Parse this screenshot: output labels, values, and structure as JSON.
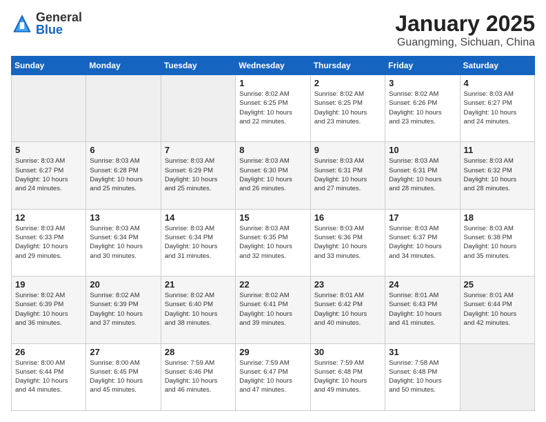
{
  "logo": {
    "general": "General",
    "blue": "Blue"
  },
  "title": "January 2025",
  "subtitle": "Guangming, Sichuan, China",
  "weekdays": [
    "Sunday",
    "Monday",
    "Tuesday",
    "Wednesday",
    "Thursday",
    "Friday",
    "Saturday"
  ],
  "weeks": [
    [
      {
        "day": "",
        "text": ""
      },
      {
        "day": "",
        "text": ""
      },
      {
        "day": "",
        "text": ""
      },
      {
        "day": "1",
        "text": "Sunrise: 8:02 AM\nSunset: 6:25 PM\nDaylight: 10 hours\nand 22 minutes."
      },
      {
        "day": "2",
        "text": "Sunrise: 8:02 AM\nSunset: 6:25 PM\nDaylight: 10 hours\nand 23 minutes."
      },
      {
        "day": "3",
        "text": "Sunrise: 8:02 AM\nSunset: 6:26 PM\nDaylight: 10 hours\nand 23 minutes."
      },
      {
        "day": "4",
        "text": "Sunrise: 8:03 AM\nSunset: 6:27 PM\nDaylight: 10 hours\nand 24 minutes."
      }
    ],
    [
      {
        "day": "5",
        "text": "Sunrise: 8:03 AM\nSunset: 6:27 PM\nDaylight: 10 hours\nand 24 minutes."
      },
      {
        "day": "6",
        "text": "Sunrise: 8:03 AM\nSunset: 6:28 PM\nDaylight: 10 hours\nand 25 minutes."
      },
      {
        "day": "7",
        "text": "Sunrise: 8:03 AM\nSunset: 6:29 PM\nDaylight: 10 hours\nand 25 minutes."
      },
      {
        "day": "8",
        "text": "Sunrise: 8:03 AM\nSunset: 6:30 PM\nDaylight: 10 hours\nand 26 minutes."
      },
      {
        "day": "9",
        "text": "Sunrise: 8:03 AM\nSunset: 6:31 PM\nDaylight: 10 hours\nand 27 minutes."
      },
      {
        "day": "10",
        "text": "Sunrise: 8:03 AM\nSunset: 6:31 PM\nDaylight: 10 hours\nand 28 minutes."
      },
      {
        "day": "11",
        "text": "Sunrise: 8:03 AM\nSunset: 6:32 PM\nDaylight: 10 hours\nand 28 minutes."
      }
    ],
    [
      {
        "day": "12",
        "text": "Sunrise: 8:03 AM\nSunset: 6:33 PM\nDaylight: 10 hours\nand 29 minutes."
      },
      {
        "day": "13",
        "text": "Sunrise: 8:03 AM\nSunset: 6:34 PM\nDaylight: 10 hours\nand 30 minutes."
      },
      {
        "day": "14",
        "text": "Sunrise: 8:03 AM\nSunset: 6:34 PM\nDaylight: 10 hours\nand 31 minutes."
      },
      {
        "day": "15",
        "text": "Sunrise: 8:03 AM\nSunset: 6:35 PM\nDaylight: 10 hours\nand 32 minutes."
      },
      {
        "day": "16",
        "text": "Sunrise: 8:03 AM\nSunset: 6:36 PM\nDaylight: 10 hours\nand 33 minutes."
      },
      {
        "day": "17",
        "text": "Sunrise: 8:03 AM\nSunset: 6:37 PM\nDaylight: 10 hours\nand 34 minutes."
      },
      {
        "day": "18",
        "text": "Sunrise: 8:03 AM\nSunset: 6:38 PM\nDaylight: 10 hours\nand 35 minutes."
      }
    ],
    [
      {
        "day": "19",
        "text": "Sunrise: 8:02 AM\nSunset: 6:39 PM\nDaylight: 10 hours\nand 36 minutes."
      },
      {
        "day": "20",
        "text": "Sunrise: 8:02 AM\nSunset: 6:39 PM\nDaylight: 10 hours\nand 37 minutes."
      },
      {
        "day": "21",
        "text": "Sunrise: 8:02 AM\nSunset: 6:40 PM\nDaylight: 10 hours\nand 38 minutes."
      },
      {
        "day": "22",
        "text": "Sunrise: 8:02 AM\nSunset: 6:41 PM\nDaylight: 10 hours\nand 39 minutes."
      },
      {
        "day": "23",
        "text": "Sunrise: 8:01 AM\nSunset: 6:42 PM\nDaylight: 10 hours\nand 40 minutes."
      },
      {
        "day": "24",
        "text": "Sunrise: 8:01 AM\nSunset: 6:43 PM\nDaylight: 10 hours\nand 41 minutes."
      },
      {
        "day": "25",
        "text": "Sunrise: 8:01 AM\nSunset: 6:44 PM\nDaylight: 10 hours\nand 42 minutes."
      }
    ],
    [
      {
        "day": "26",
        "text": "Sunrise: 8:00 AM\nSunset: 6:44 PM\nDaylight: 10 hours\nand 44 minutes."
      },
      {
        "day": "27",
        "text": "Sunrise: 8:00 AM\nSunset: 6:45 PM\nDaylight: 10 hours\nand 45 minutes."
      },
      {
        "day": "28",
        "text": "Sunrise: 7:59 AM\nSunset: 6:46 PM\nDaylight: 10 hours\nand 46 minutes."
      },
      {
        "day": "29",
        "text": "Sunrise: 7:59 AM\nSunset: 6:47 PM\nDaylight: 10 hours\nand 47 minutes."
      },
      {
        "day": "30",
        "text": "Sunrise: 7:59 AM\nSunset: 6:48 PM\nDaylight: 10 hours\nand 49 minutes."
      },
      {
        "day": "31",
        "text": "Sunrise: 7:58 AM\nSunset: 6:48 PM\nDaylight: 10 hours\nand 50 minutes."
      },
      {
        "day": "",
        "text": ""
      }
    ]
  ]
}
